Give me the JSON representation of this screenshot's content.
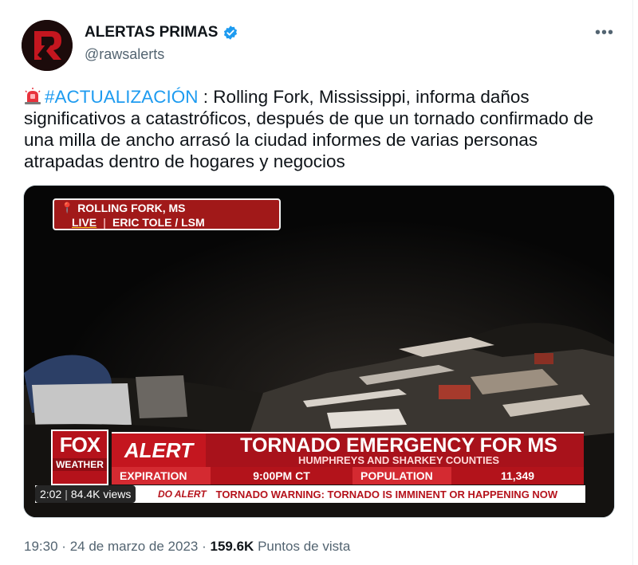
{
  "author": {
    "display_name": "ALERTAS PRIMAS",
    "handle": "@rawsalerts"
  },
  "menu": {
    "more_label": "•••"
  },
  "tweet": {
    "emoji": "siren-emoji",
    "hashtag": "#ACTUALIZACIÓN",
    "text": " : Rolling Fork, Mississippi, informa daños significativos a catastróficos, después de que un tornado confirmado de una milla de ancho arrasó la ciudad informes de varias personas atrapadas dentro de hogares y negocios"
  },
  "video": {
    "location": "ROLLING FORK, MS",
    "live": "LIVE",
    "reporter": "ERIC TOLE / LSM",
    "logo_top": "FOX",
    "logo_bottom": "WEATHER",
    "alert_word": "ALERT",
    "alert_title": "TORNADO EMERGENCY FOR MS",
    "alert_subtitle": "HUMPHREYS AND SHARKEY COUNTIES",
    "expiration_label": "EXPIRATION",
    "expiration_value": "9:00PM CT",
    "population_label": "POPULATION",
    "population_value": "11,349",
    "ticker_tag": "DO ALERT",
    "ticker_text": "TORNADO WARNING: TORNADO IS IMMINENT OR HAPPENING NOW",
    "duration": "2:02",
    "views": "84.4K views"
  },
  "meta": {
    "time": "19:30",
    "date": "24 de marzo de 2023",
    "view_count": "159.6K",
    "view_label": "Puntos de vista",
    "separator": "·"
  },
  "colors": {
    "link": "#1d9bf0",
    "verified": "#1d9bf0",
    "alert_red": "#a8121b"
  }
}
